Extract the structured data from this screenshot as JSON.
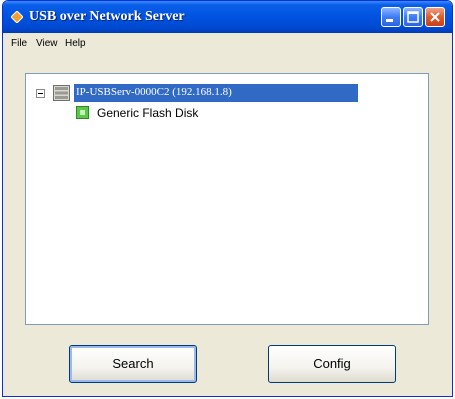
{
  "window": {
    "title": "USB over Network Server"
  },
  "menu": {
    "items": [
      "File",
      "View",
      "Help"
    ]
  },
  "tree": {
    "server": {
      "label": "IP-USBServ-0000C2 (192.168.1.8)",
      "icon": "server-icon",
      "expanded": true,
      "selected": true
    },
    "devices": [
      {
        "label": "Generic Flash Disk",
        "icon": "usb-disk-icon"
      }
    ]
  },
  "buttons": {
    "search": "Search",
    "config": "Config"
  },
  "colors": {
    "titlebar": "#0053e0",
    "selection": "#316ac5",
    "window_bg": "#ece9d8",
    "device_icon": "#5cc84a",
    "close_button": "#e05a2a"
  }
}
